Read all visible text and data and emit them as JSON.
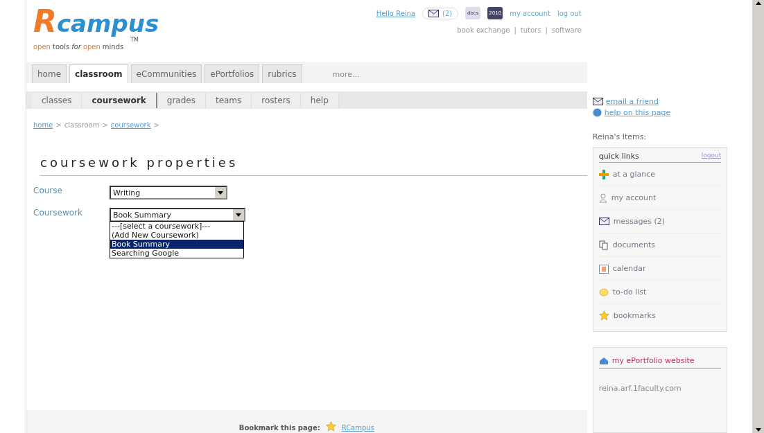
{
  "header": {
    "logo": {
      "initial": "R",
      "rest": "campus",
      "tm": "TM",
      "tagline": [
        {
          "text": "open",
          "kind": "accent"
        },
        {
          "text": "tools",
          "kind": "plain"
        },
        {
          "text": "for",
          "kind": "italic"
        },
        {
          "text": "open",
          "kind": "accent"
        },
        {
          "text": "minds",
          "kind": "plain"
        }
      ]
    },
    "greeting": "Hello Reina",
    "message_count": "(2)",
    "docs_label": "docs",
    "calendar_label": "2010",
    "account_links": [
      "my account",
      "log out"
    ],
    "secondary_links": [
      "book exchange",
      "tutors",
      "software"
    ],
    "link_separator": "|"
  },
  "main_tabs": [
    {
      "label": "home",
      "selected": false
    },
    {
      "label": "classroom",
      "selected": true
    },
    {
      "label": "eCommunities",
      "selected": false
    },
    {
      "label": "ePortfolios",
      "selected": false
    },
    {
      "label": "rubrics",
      "selected": false
    }
  ],
  "more_link": "more...",
  "sub_tabs": [
    {
      "label": "classes",
      "selected": false
    },
    {
      "label": "coursework",
      "selected": true
    },
    {
      "label": "grades",
      "selected": false
    },
    {
      "label": "teams",
      "selected": false
    },
    {
      "label": "rosters",
      "selected": false
    },
    {
      "label": "help",
      "selected": false
    }
  ],
  "breadcrumb": {
    "separator": ">",
    "items": [
      {
        "label": "home",
        "link": true
      },
      {
        "label": "classroom",
        "link": false
      },
      {
        "label": "coursework",
        "link": true
      }
    ]
  },
  "page_title": "coursework properties",
  "form": [
    {
      "label": "Course",
      "value": "Writing",
      "expanded": false
    },
    {
      "label": "Coursework",
      "value": "Book Summary",
      "expanded": true,
      "options": [
        {
          "label": "---[select a coursework]---",
          "selected": false
        },
        {
          "label": "(Add New Coursework)",
          "selected": false
        },
        {
          "label": "Book Summary",
          "selected": true
        },
        {
          "label": "Searching Google",
          "selected": false
        }
      ]
    }
  ],
  "footer": {
    "label": "Bookmark this page:",
    "link": "RCampus"
  },
  "sidebar": {
    "links": [
      "email a friend",
      "help on this page"
    ],
    "items_heading": "Reina's Items:",
    "quick_links": {
      "title": "quick links",
      "action": "logout",
      "items": [
        "at a glance",
        "my account",
        "messages (2)",
        "documents",
        "calendar",
        "to-do list",
        "bookmarks"
      ]
    },
    "eportfolio": {
      "title": "my ePortfolio website",
      "url": "reina.arf.1faculty.com"
    }
  }
}
